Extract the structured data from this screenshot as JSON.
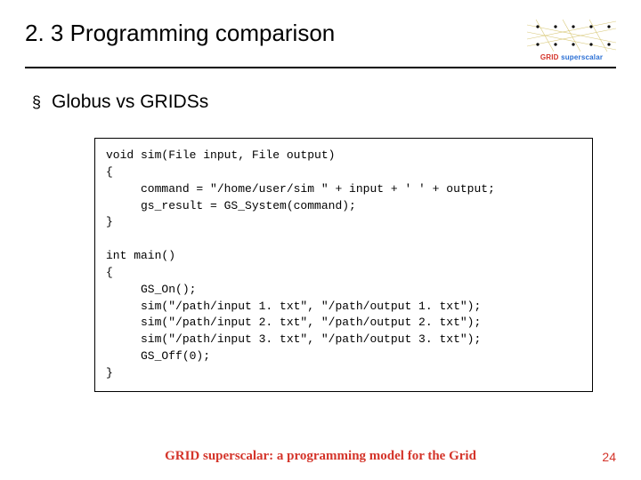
{
  "header": {
    "title": "2. 3 Programming comparison",
    "logo_brand_a": "GRID",
    "logo_brand_b": "superscalar"
  },
  "bullet": {
    "marker": "§",
    "text": "Globus vs GRIDSs"
  },
  "code": {
    "lines": [
      "void sim(File input, File output)",
      "{",
      "     command = \"/home/user/sim \" + input + ' ' + output;",
      "     gs_result = GS_System(command);",
      "}",
      "",
      "int main()",
      "{",
      "     GS_On();",
      "     sim(\"/path/input 1. txt\", \"/path/output 1. txt\");",
      "     sim(\"/path/input 2. txt\", \"/path/output 2. txt\");",
      "     sim(\"/path/input 3. txt\", \"/path/output 3. txt\");",
      "     GS_Off(0);",
      "}"
    ]
  },
  "footer": {
    "text": "GRID superscalar: a programming model for the Grid",
    "page": "24"
  }
}
